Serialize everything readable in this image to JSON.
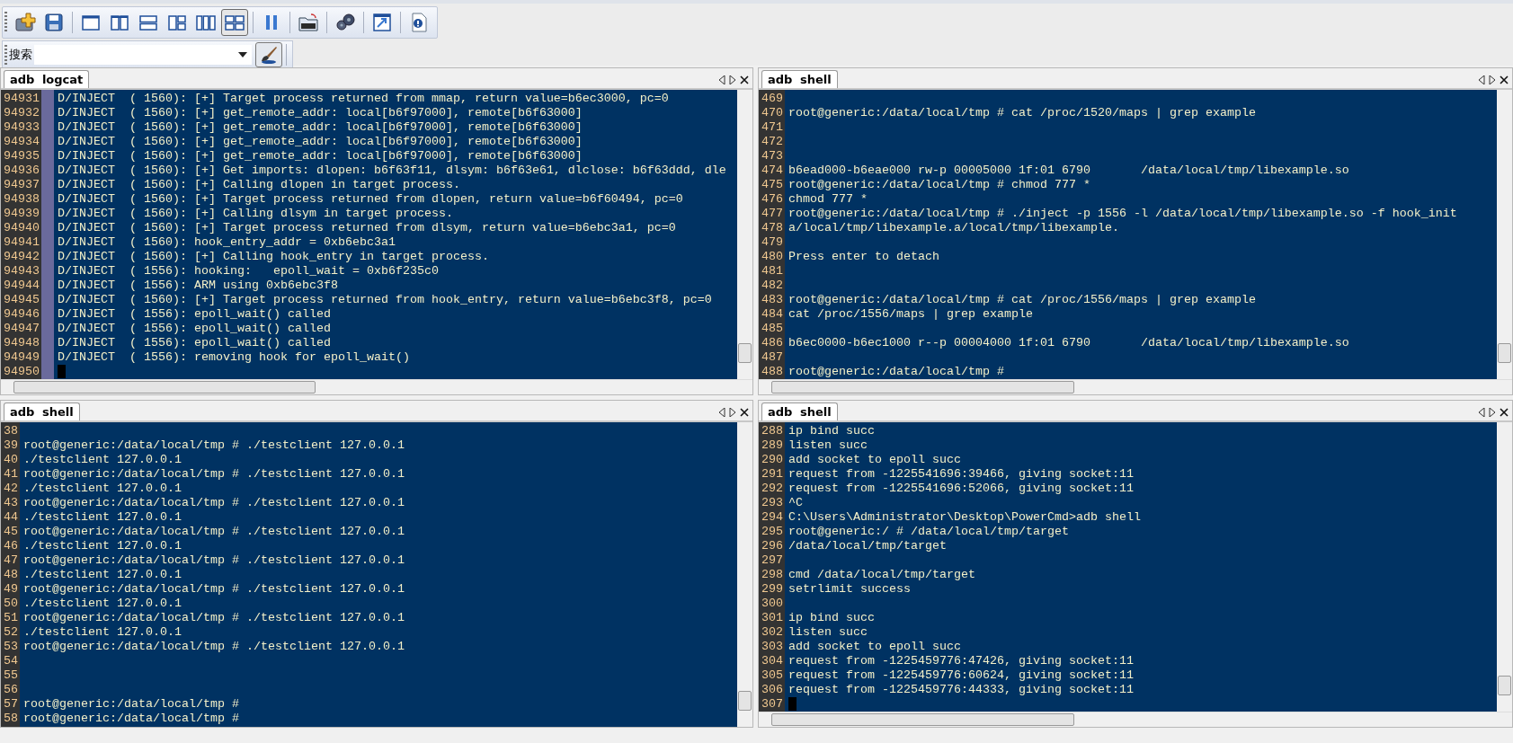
{
  "toolbar": {
    "groups": [
      [
        {
          "kind": "new",
          "selected": false
        },
        {
          "kind": "save",
          "selected": false
        }
      ],
      [
        {
          "kind": "layout-single",
          "selected": false
        },
        {
          "kind": "layout-columns-2",
          "selected": false
        },
        {
          "kind": "layout-rows-2",
          "selected": false
        },
        {
          "kind": "layout-mixed",
          "selected": false
        },
        {
          "kind": "layout-columns-3",
          "selected": false
        },
        {
          "kind": "layout-grid",
          "selected": true
        }
      ],
      [
        {
          "kind": "pause",
          "selected": false
        }
      ],
      [
        {
          "kind": "log",
          "selected": false
        }
      ],
      [
        {
          "kind": "gears",
          "selected": false
        }
      ],
      [
        {
          "kind": "popout",
          "selected": false
        }
      ],
      [
        {
          "kind": "help",
          "selected": false
        }
      ]
    ]
  },
  "search": {
    "label": "搜索"
  },
  "panes": [
    {
      "tab": "adb logcat",
      "marker_column": true,
      "horizontal_scrollbar": true,
      "lines": [
        {
          "number": "94931",
          "text": "D/INJECT  ( 1560): [+] Target process returned from mmap, return value=b6ec3000, pc=0"
        },
        {
          "number": "94932",
          "text": "D/INJECT  ( 1560): [+] get_remote_addr: local[b6f97000], remote[b6f63000]"
        },
        {
          "number": "94933",
          "text": "D/INJECT  ( 1560): [+] get_remote_addr: local[b6f97000], remote[b6f63000]"
        },
        {
          "number": "94934",
          "text": "D/INJECT  ( 1560): [+] get_remote_addr: local[b6f97000], remote[b6f63000]"
        },
        {
          "number": "94935",
          "text": "D/INJECT  ( 1560): [+] get_remote_addr: local[b6f97000], remote[b6f63000]"
        },
        {
          "number": "94936",
          "text": "D/INJECT  ( 1560): [+] Get imports: dlopen: b6f63f11, dlsym: b6f63e61, dlclose: b6f63ddd, dle"
        },
        {
          "number": "94937",
          "text": "D/INJECT  ( 1560): [+] Calling dlopen in target process."
        },
        {
          "number": "94938",
          "text": "D/INJECT  ( 1560): [+] Target process returned from dlopen, return value=b6f60494, pc=0"
        },
        {
          "number": "94939",
          "text": "D/INJECT  ( 1560): [+] Calling dlsym in target process."
        },
        {
          "number": "94940",
          "text": "D/INJECT  ( 1560): [+] Target process returned from dlsym, return value=b6ebc3a1, pc=0"
        },
        {
          "number": "94941",
          "text": "D/INJECT  ( 1560): hook_entry_addr = 0xb6ebc3a1"
        },
        {
          "number": "94942",
          "text": "D/INJECT  ( 1560): [+] Calling hook_entry in target process."
        },
        {
          "number": "94943",
          "text": "D/INJECT  ( 1556): hooking:   epoll_wait = 0xb6f235c0"
        },
        {
          "number": "94944",
          "text": "D/INJECT  ( 1556): ARM using 0xb6ebc3f8"
        },
        {
          "number": "94945",
          "text": "D/INJECT  ( 1560): [+] Target process returned from hook_entry, return value=b6ebc3f8, pc=0"
        },
        {
          "number": "94946",
          "text": "D/INJECT  ( 1556): epoll_wait() called"
        },
        {
          "number": "94947",
          "text": "D/INJECT  ( 1556): epoll_wait() called"
        },
        {
          "number": "94948",
          "text": "D/INJECT  ( 1556): epoll_wait() called"
        },
        {
          "number": "94949",
          "text": "D/INJECT  ( 1556): removing hook for epoll_wait()"
        },
        {
          "number": "94950",
          "cursor": true
        }
      ]
    },
    {
      "tab": "adb shell",
      "marker_column": false,
      "horizontal_scrollbar": true,
      "lines": [
        {
          "number": "469"
        },
        {
          "number": "470",
          "text": "root@generic:/data/local/tmp # cat /proc/1520/maps | grep example"
        },
        {
          "number": "471"
        },
        {
          "number": "472"
        },
        {
          "number": "473"
        },
        {
          "number": "474",
          "text": "b6ead000-b6eae000 rw-p 00005000 1f:01 6790       /data/local/tmp/libexample.so"
        },
        {
          "number": "475",
          "text": "root@generic:/data/local/tmp # chmod 777 *"
        },
        {
          "number": "476",
          "text": "chmod 777 *"
        },
        {
          "number": "477",
          "text": "root@generic:/data/local/tmp # ./inject -p 1556 -l /data/local/tmp/libexample.so -f hook_init"
        },
        {
          "number": "478",
          "text": "a/local/tmp/libexample.a/local/tmp/libexample."
        },
        {
          "number": "479"
        },
        {
          "number": "480",
          "text": "Press enter to detach"
        },
        {
          "number": "481"
        },
        {
          "number": "482"
        },
        {
          "number": "483",
          "text": "root@generic:/data/local/tmp # cat /proc/1556/maps | grep example"
        },
        {
          "number": "484",
          "text": "cat /proc/1556/maps | grep example"
        },
        {
          "number": "485"
        },
        {
          "number": "486",
          "text": "b6ec0000-b6ec1000 r--p 00004000 1f:01 6790       /data/local/tmp/libexample.so"
        },
        {
          "number": "487"
        },
        {
          "number": "488",
          "text": "root@generic:/data/local/tmp #"
        }
      ]
    },
    {
      "tab": "adb shell",
      "marker_column": false,
      "horizontal_scrollbar": false,
      "lines": [
        {
          "number": "38"
        },
        {
          "number": "39",
          "text": "root@generic:/data/local/tmp # ./testclient 127.0.0.1"
        },
        {
          "number": "40",
          "text": "./testclient 127.0.0.1"
        },
        {
          "number": "41",
          "text": "root@generic:/data/local/tmp # ./testclient 127.0.0.1"
        },
        {
          "number": "42",
          "text": "./testclient 127.0.0.1"
        },
        {
          "number": "43",
          "text": "root@generic:/data/local/tmp # ./testclient 127.0.0.1"
        },
        {
          "number": "44",
          "text": "./testclient 127.0.0.1"
        },
        {
          "number": "45",
          "text": "root@generic:/data/local/tmp # ./testclient 127.0.0.1"
        },
        {
          "number": "46",
          "text": "./testclient 127.0.0.1"
        },
        {
          "number": "47",
          "text": "root@generic:/data/local/tmp # ./testclient 127.0.0.1"
        },
        {
          "number": "48",
          "text": "./testclient 127.0.0.1"
        },
        {
          "number": "49",
          "text": "root@generic:/data/local/tmp # ./testclient 127.0.0.1"
        },
        {
          "number": "50",
          "text": "./testclient 127.0.0.1"
        },
        {
          "number": "51",
          "text": "root@generic:/data/local/tmp # ./testclient 127.0.0.1"
        },
        {
          "number": "52",
          "text": "./testclient 127.0.0.1"
        },
        {
          "number": "53",
          "text": "root@generic:/data/local/tmp # ./testclient 127.0.0.1"
        },
        {
          "number": "54"
        },
        {
          "number": "55"
        },
        {
          "number": "56"
        },
        {
          "number": "57",
          "text": "root@generic:/data/local/tmp #"
        },
        {
          "number": "58",
          "text": "root@generic:/data/local/tmp #"
        }
      ]
    },
    {
      "tab": "adb shell",
      "marker_column": false,
      "horizontal_scrollbar": true,
      "lines": [
        {
          "number": "288",
          "text": "ip bind succ"
        },
        {
          "number": "289",
          "text": "listen succ"
        },
        {
          "number": "290",
          "text": "add socket to epoll succ"
        },
        {
          "number": "291",
          "text": "request from -1225541696:39466, giving socket:11"
        },
        {
          "number": "292",
          "text": "request from -1225541696:52066, giving socket:11"
        },
        {
          "number": "293",
          "text": "^C"
        },
        {
          "number": "294",
          "text": "C:\\Users\\Administrator\\Desktop\\PowerCmd>adb shell"
        },
        {
          "number": "295",
          "text": "root@generic:/ # /data/local/tmp/target"
        },
        {
          "number": "296",
          "text": "/data/local/tmp/target"
        },
        {
          "number": "297"
        },
        {
          "number": "298",
          "text": "cmd /data/local/tmp/target"
        },
        {
          "number": "299",
          "text": "setrlimit success"
        },
        {
          "number": "300"
        },
        {
          "number": "301",
          "text": "ip bind succ"
        },
        {
          "number": "302",
          "text": "listen succ"
        },
        {
          "number": "303",
          "text": "add socket to epoll succ"
        },
        {
          "number": "304",
          "text": "request from -1225459776:47426, giving socket:11"
        },
        {
          "number": "305",
          "text": "request from -1225459776:60624, giving socket:11"
        },
        {
          "number": "306",
          "text": "request from -1225459776:44333, giving socket:11"
        },
        {
          "number": "307",
          "cursor": true
        }
      ]
    }
  ]
}
